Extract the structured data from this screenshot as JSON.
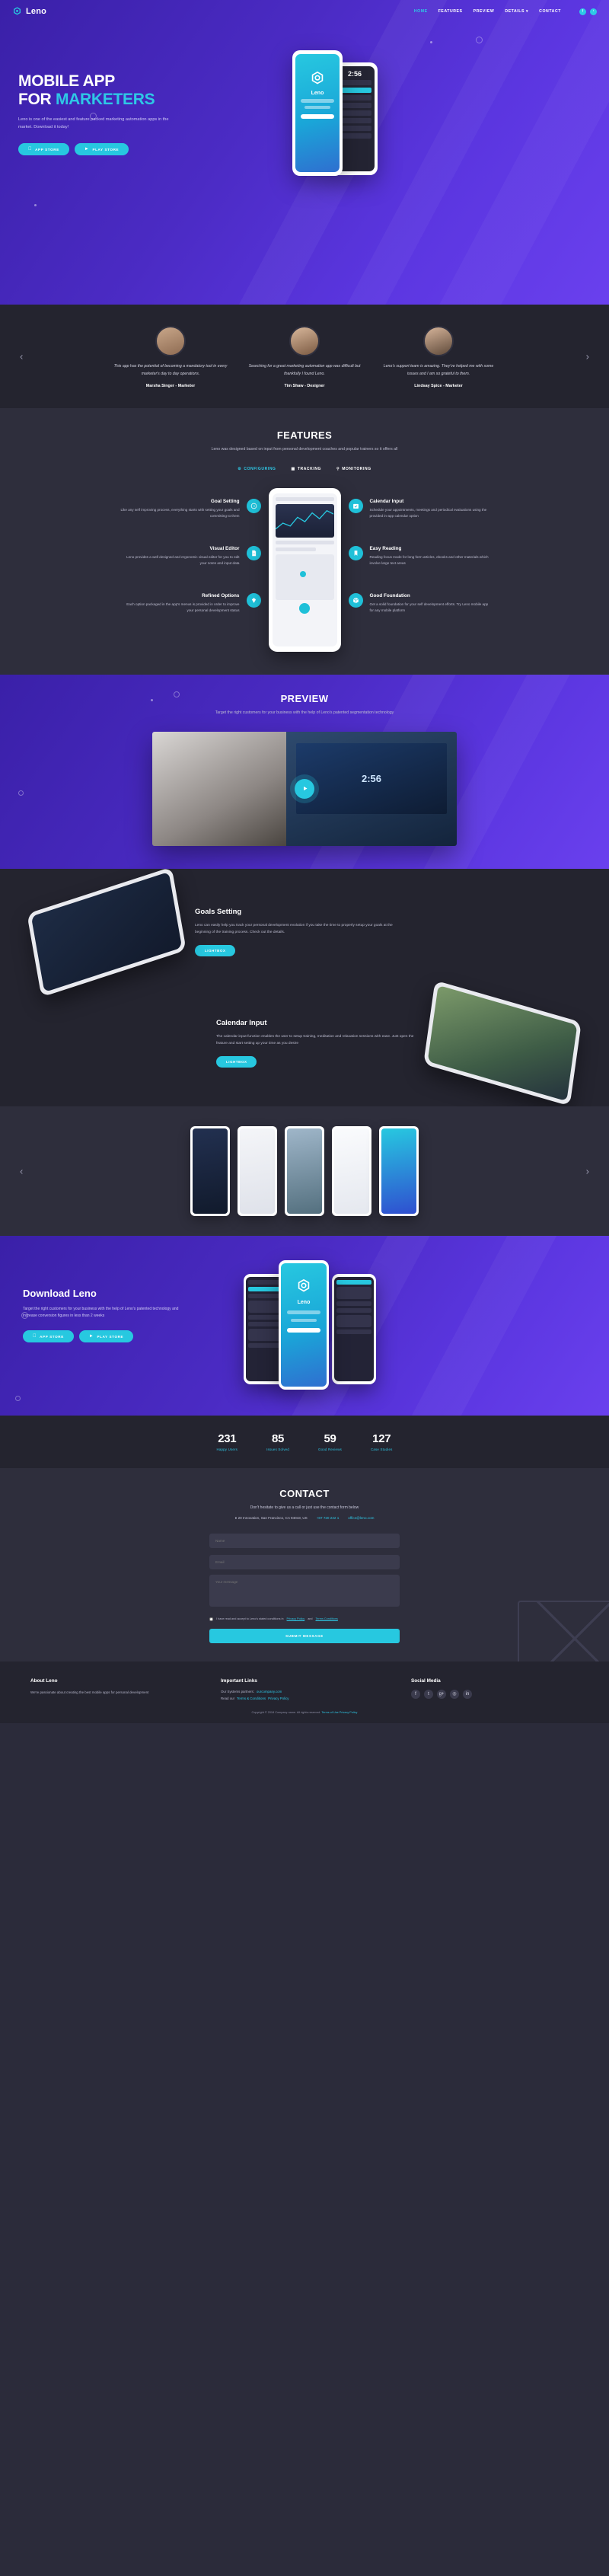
{
  "brand": {
    "name": "Leno",
    "logo_icon": "hexagon-logo-icon"
  },
  "nav": {
    "items": [
      {
        "label": "HOME",
        "active": true
      },
      {
        "label": "FEATURES",
        "active": false
      },
      {
        "label": "PREVIEW",
        "active": false
      },
      {
        "label": "DETAILS ▾",
        "active": false
      },
      {
        "label": "CONTACT",
        "active": false
      }
    ],
    "social": [
      {
        "icon": "facebook-icon",
        "glyph": "f"
      },
      {
        "icon": "twitter-icon",
        "glyph": "ᵗ"
      }
    ]
  },
  "hero": {
    "title_line1": "MOBILE APP",
    "title_line2_a": "FOR ",
    "title_line2_b": "MARKETERS",
    "subtitle": "Leno is one of the easiest and feature packed marketing automation apps in the market. Download it today!",
    "buttons": [
      {
        "label": "APP STORE",
        "icon": "apple-icon",
        "glyph": ""
      },
      {
        "label": "PLAY STORE",
        "icon": "play-icon",
        "glyph": "▶"
      }
    ],
    "phone_front": {
      "app_name": "Leno",
      "cta": ""
    },
    "phone_back": {
      "time": "2:56"
    }
  },
  "testimonials": {
    "prev_icon": "chevron-left-icon",
    "next_icon": "chevron-right-icon",
    "items": [
      {
        "quote": "This app has the potential of becoming a mandatory tool in every marketer's day to day operations.",
        "name": "Marsha Singer - Marketer",
        "avatar": "avatar-marsha"
      },
      {
        "quote": "Searching for a great marketing automation app was difficult but thankfully I found Leno.",
        "name": "Tim Shaw - Designer",
        "avatar": "avatar-tim"
      },
      {
        "quote": "Leno's support team is amazing. They've helped me with some issues and I am so grateful to them.",
        "name": "Lindsay Spice - Marketer",
        "avatar": "avatar-lindsay"
      }
    ]
  },
  "features": {
    "title": "FEATURES",
    "subtitle": "Leno was designed based on input from personal development coaches and popular trainers so it offers all",
    "tabs": [
      {
        "label": "CONFIGURING",
        "icon": "gear-icon",
        "glyph": "⚙",
        "active": true
      },
      {
        "label": "TRACKING",
        "icon": "footsteps-icon",
        "glyph": "☷",
        "active": false
      },
      {
        "label": "MONITORING",
        "icon": "search-icon",
        "glyph": "⌕",
        "active": false
      }
    ],
    "left": [
      {
        "title": "Goal Setting",
        "text": "Like any self improving process, everything starts with setting your goals and committing to them",
        "icon": "compass-icon",
        "glyph": "✵"
      },
      {
        "title": "Visual Editor",
        "text": "Leno provides a well designed and ergonomic visual editor for you to edit your notes and input data",
        "icon": "code-file-icon",
        "glyph": "☰"
      },
      {
        "title": "Refined Options",
        "text": "Each option packaged in the app's menus is provided in order to improve your personal development status",
        "icon": "diamond-icon",
        "glyph": "◆"
      }
    ],
    "right": [
      {
        "title": "Calendar Input",
        "text": "Schedule your appointments, meetings and periodical evaluations using the provided in-app calendar option",
        "icon": "calendar-check-icon",
        "glyph": "✓"
      },
      {
        "title": "Easy Reading",
        "text": "Reading focus mode for long form articles, ebooks and other materials which involve large text areas",
        "icon": "bookmark-icon",
        "glyph": "⚑"
      },
      {
        "title": "Good Foundation",
        "text": "Get a solid foundation for your self development efforts. Try Leno mobile app for any mobile platform",
        "icon": "box-icon",
        "glyph": "⬡"
      }
    ]
  },
  "preview": {
    "title": "PREVIEW",
    "subtitle": "Target the right customers for your business with the help of Leno's patented segmentation technology",
    "play_icon": "play-button-icon",
    "screen_time": "2:56"
  },
  "details": {
    "items": [
      {
        "title": "Goals Setting",
        "text": "Leno can easily help you track your personal development evolution if you take the time to properly setup your goals at the beginning of the training process. Check out the details.",
        "button": "LIGHTBOX"
      },
      {
        "title": "Calendar Input",
        "text": "The calendar input function enables the user to setup training, meditation and relaxation sessions with ease. Just open the feature and start setting up your time as you desire",
        "button": "LIGHTBOX"
      }
    ]
  },
  "screenshots": {
    "prev_icon": "chevron-left-icon",
    "next_icon": "chevron-right-icon",
    "items": [
      {
        "name": "screenshot-dashboard"
      },
      {
        "name": "screenshot-article"
      },
      {
        "name": "screenshot-photo"
      },
      {
        "name": "screenshot-list"
      },
      {
        "name": "screenshot-chart"
      }
    ]
  },
  "download": {
    "title": "Download Leno",
    "text": "Target the right customers for your business with the help of Leno's patented technology and increase conversion figures in less than 2 weeks",
    "buttons": [
      {
        "label": "APP STORE",
        "icon": "apple-icon",
        "glyph": ""
      },
      {
        "label": "PLAY STORE",
        "icon": "play-icon",
        "glyph": "▶"
      }
    ],
    "center_app_name": "Leno"
  },
  "stats": [
    {
      "number": "231",
      "label": "Happy Users"
    },
    {
      "number": "85",
      "label": "Issues Solved"
    },
    {
      "number": "59",
      "label": "Good Reviews"
    },
    {
      "number": "127",
      "label": "Case Studies"
    }
  ],
  "contact": {
    "title": "CONTACT",
    "lead": "Don't hesitate to give us a call or just use the contact form below",
    "address": "20 Innovation, San Francisco, CA 94043, US",
    "address_icon": "location-pin-icon",
    "phone": "+87 720 222 1",
    "phone_icon": "phone-icon",
    "email": "office@leno.com",
    "email_icon": "envelope-icon",
    "fields": [
      {
        "name": "name-field",
        "placeholder": "Name",
        "value": ""
      },
      {
        "name": "email-field",
        "placeholder": "Email",
        "value": ""
      },
      {
        "name": "message-field",
        "placeholder": "Your message",
        "value": ""
      }
    ],
    "consent_text": "I have read and accept to Leno's stated conditions in",
    "consent_link1": "Privacy Policy",
    "consent_and": "and",
    "consent_link2": "Terms Conditions",
    "submit_label": "SUBMIT MESSAGE",
    "envelope_icon": "envelope-outline-icon"
  },
  "footer": {
    "about": {
      "title": "About Leno",
      "text": "We're passionate about creating the best mobile apps for personal development"
    },
    "links": {
      "title": "Important Links",
      "items": [
        {
          "prefix": "Our Systems partners:",
          "link": "ourcompany.com"
        },
        {
          "prefix": "Read our",
          "link": "Terms & Conditions",
          "link2": "Privacy Policy"
        }
      ]
    },
    "social": {
      "title": "Social Media",
      "icons": [
        {
          "icon": "facebook-icon",
          "glyph": "f"
        },
        {
          "icon": "twitter-icon",
          "glyph": "t"
        },
        {
          "icon": "google-plus-icon",
          "glyph": "g+"
        },
        {
          "icon": "instagram-icon",
          "glyph": "◎"
        },
        {
          "icon": "linkedin-icon",
          "glyph": "in"
        }
      ]
    },
    "copyright_pre": "Copyright © 2018 Company name. All rights reserved.",
    "copyright_link1": "Terms of Use",
    "copyright_link2": "Privacy Policy"
  },
  "colors": {
    "accent": "#27c8e0",
    "purple": "#4b2bc4",
    "dark": "#24242f",
    "panel": "#2e2e3c"
  }
}
